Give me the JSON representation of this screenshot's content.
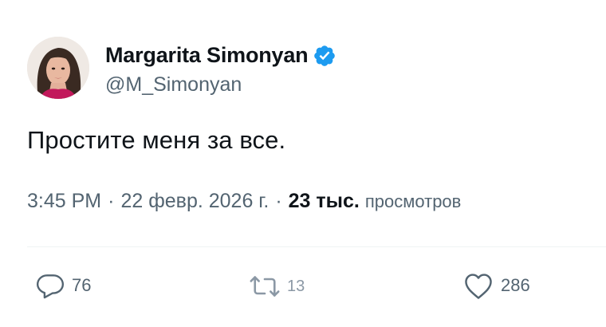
{
  "author": {
    "display_name": "Margarita Simonyan",
    "handle": "@M_Simonyan",
    "verified_icon": "verified-badge-icon"
  },
  "tweet": {
    "text": "Простите меня за все."
  },
  "meta": {
    "time": "3:45 PM",
    "separator1": "·",
    "date": "22 февр. 2026 г.",
    "separator2": "·",
    "views_count": "23 тыс.",
    "views_label": "просмотров"
  },
  "actions": {
    "replies": "76",
    "reposts": "13",
    "likes": "286"
  },
  "colors": {
    "text_primary": "#0f1419",
    "text_secondary": "#536471",
    "verified_blue": "#1d9bf0",
    "divider": "#eff3f4"
  }
}
